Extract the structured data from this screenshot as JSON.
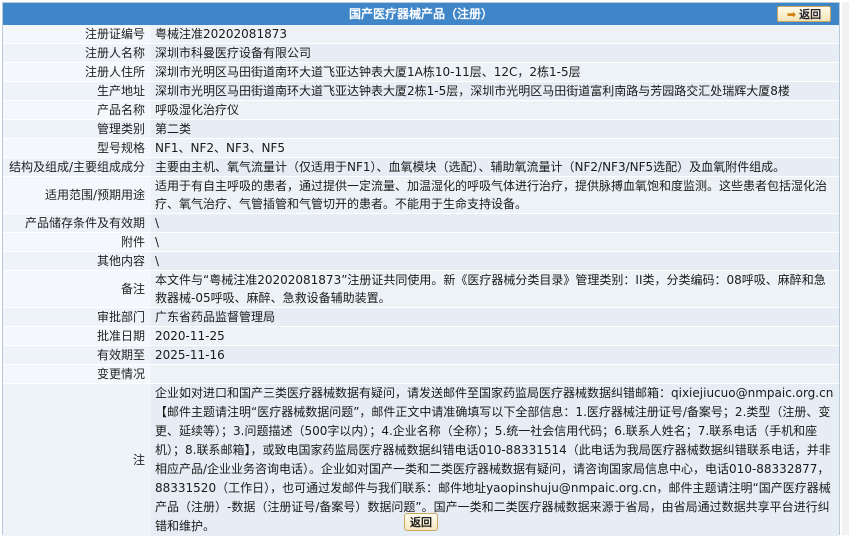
{
  "header": {
    "title": "国产医疗器械产品（注册）",
    "back_label": "返回"
  },
  "fields": [
    {
      "label": "注册证编号",
      "value": "粤械注准20202081873"
    },
    {
      "label": "注册人名称",
      "value": "深圳市科曼医疗设备有限公司"
    },
    {
      "label": "注册人住所",
      "value": "深圳市光明区马田街道南环大道飞亚达钟表大厦1A栋10-11层、12C，2栋1-5层"
    },
    {
      "label": "生产地址",
      "value": "深圳市光明区马田街道南环大道飞亚达钟表大厦2栋1-5层，深圳市光明区马田街道富利南路与芳园路交汇处瑞辉大厦8楼"
    },
    {
      "label": "产品名称",
      "value": "呼吸湿化治疗仪"
    },
    {
      "label": "管理类别",
      "value": "第二类"
    },
    {
      "label": "型号规格",
      "value": "NF1、NF2、NF3、NF5"
    },
    {
      "label": "结构及组成/主要组成成分",
      "value": "主要由主机、氧气流量计（仅适用于NF1）、血氧模块（选配）、辅助氧流量计（NF2/NF3/NF5选配）及血氧附件组成。"
    },
    {
      "label": "适用范围/预期用途",
      "value": "适用于有自主呼吸的患者，通过提供一定流量、加温湿化的呼吸气体进行治疗，提供脉搏血氧饱和度监测。这些患者包括湿化治疗、氧气治疗、气管插管和气管切开的患者。不能用于生命支持设备。"
    },
    {
      "label": "产品储存条件及有效期",
      "value": "\\"
    },
    {
      "label": "附件",
      "value": "\\"
    },
    {
      "label": "其他内容",
      "value": "\\"
    },
    {
      "label": "备注",
      "value": "本文件与“粤械注准20202081873”注册证共同使用。新《医疗器械分类目录》管理类别：II类，分类编码：08呼吸、麻醉和急救器械-05呼吸、麻醉、急救设备辅助装置。"
    },
    {
      "label": "审批部门",
      "value": "广东省药品监督管理局"
    },
    {
      "label": "批准日期",
      "value": "2020-11-25"
    },
    {
      "label": "有效期至",
      "value": "2025-11-16"
    },
    {
      "label": "变更情况",
      "value": ""
    }
  ],
  "note": {
    "label": "注",
    "text": "企业如对进口和国产三类医疗器械数据有疑问，请发送邮件至国家药监局医疗器械数据纠错邮箱：qixiejiucuo@nmpaic.org.cn【邮件主题请注明“医疗器械数据问题”，邮件正文中请准确填写以下全部信息：1.医疗器械注册证号/备案号；2.类型（注册、变更、延续等）；3.问题描述（500字以内）；4.企业名称（全称）；5.统一社会信用代码；6.联系人姓名；7.联系电话（手机和座机）；8.联系邮箱】，或致电国家药监局医疗器械数据纠错电话010-88331514（此电话为我局医疗器械数据纠错联系电话，并非相应产品/企业业务咨询电话）。企业如对国产一类和二类医疗器械数据有疑问，请咨询国家局信息中心，电话010-88332877，88331520（工作日），也可通过发邮件与我们联系：邮件地址yaopinshuju@nmpaic.org.cn，邮件主题请注明“国产医疗器械产品（注册）-数据（注册证号/备案号）数据问题”。国产一类和二类医疗器械数据来源于省局，由省局通过数据共享平台进行纠错和维护。"
  },
  "footer": {
    "back_label": "返回"
  },
  "colors": {
    "title_bar": "#3f86c8",
    "label_bg": "#f4f8fc",
    "value_bg": "#edf2f7"
  },
  "icons": {
    "back": "back-arrow-icon"
  }
}
